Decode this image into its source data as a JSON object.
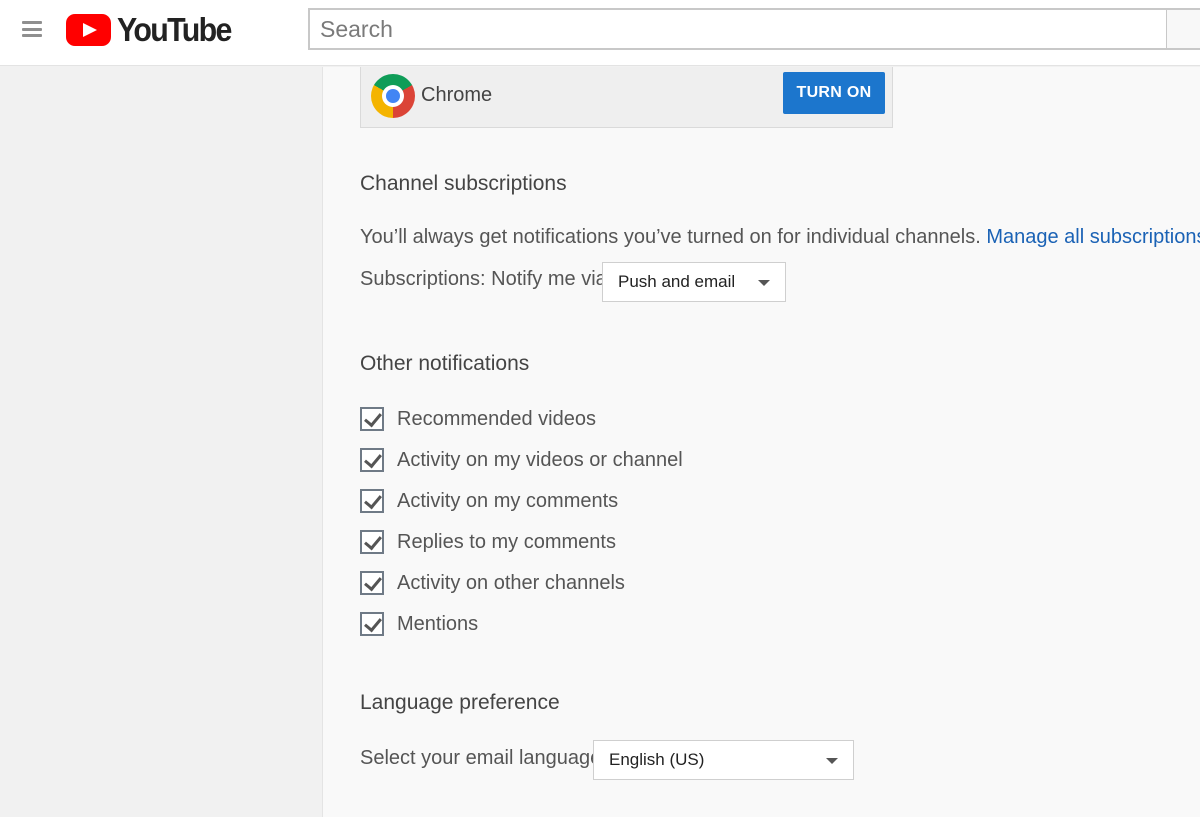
{
  "header": {
    "logo_text": "YouTube",
    "search_placeholder": "Search"
  },
  "push_devices": {
    "browser_name": "Chrome",
    "turn_on_label": "TURN ON"
  },
  "channel_subscriptions": {
    "heading": "Channel subscriptions",
    "description": "You’ll always get notifications you’ve turned on for individual channels.",
    "manage_link": "Manage all subscriptions",
    "notify_label": "Subscriptions: Notify me via",
    "notify_value": "Push and email"
  },
  "other_notifications": {
    "heading": "Other notifications",
    "items": [
      {
        "label": "Recommended videos",
        "checked": true
      },
      {
        "label": "Activity on my videos or channel",
        "checked": true
      },
      {
        "label": "Activity on my comments",
        "checked": true
      },
      {
        "label": "Replies to my comments",
        "checked": true
      },
      {
        "label": "Activity on other channels",
        "checked": true
      },
      {
        "label": "Mentions",
        "checked": true
      }
    ]
  },
  "language_preference": {
    "heading": "Language preference",
    "label": "Select your email language",
    "value": "English (US)"
  },
  "colors": {
    "brand_red": "#ff0000",
    "button_blue": "#1c76cd",
    "link_blue": "#1a62b5"
  }
}
